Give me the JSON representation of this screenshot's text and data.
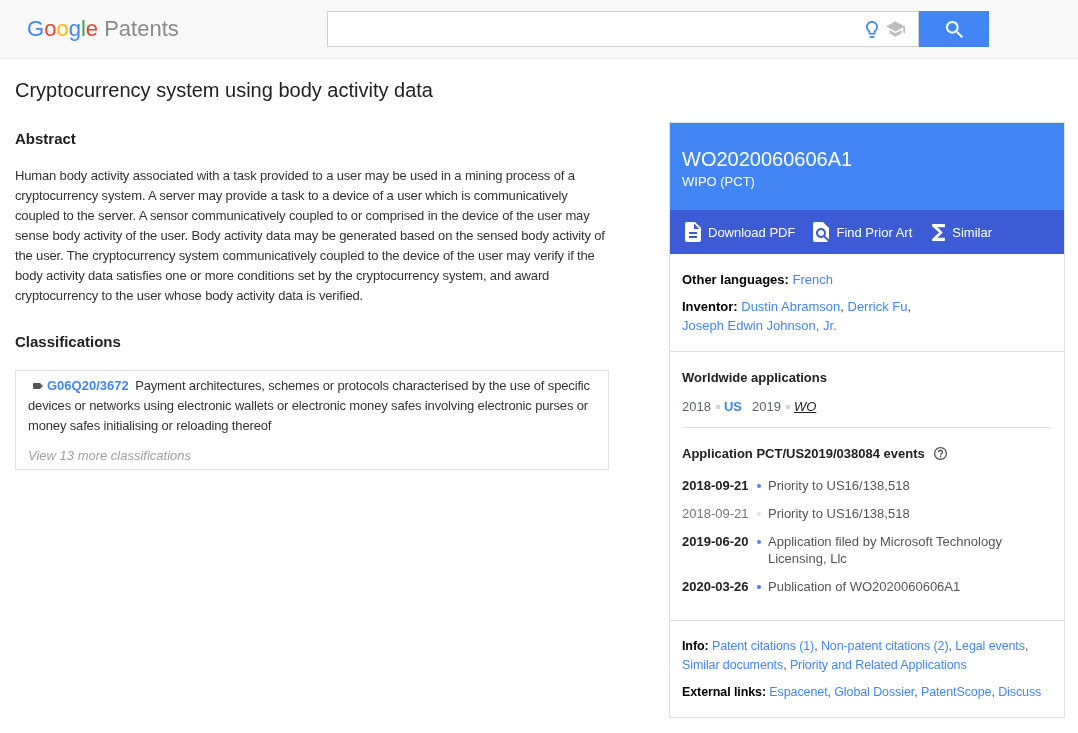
{
  "header": {
    "logo": {
      "brand": "Google",
      "product": "Patents"
    }
  },
  "title": "Cryptocurrency system using body activity data",
  "abstract": {
    "heading": "Abstract",
    "text": "Human body activity associated with a task provided to a user may be used in a mining process of a cryptocurrency system. A server may provide a task to a device of a user which is communicatively coupled to the server. A sensor communicatively coupled to or comprised in the device of the user may sense body activity of the user. Body activity data may be generated based on the sensed body activity of the user. The cryptocurrency system communicatively coupled to the device of the user may verify if the body activity data satisfies one or more conditions set by the cryptocurrency system, and award cryptocurrency to the user whose body activity data is verified."
  },
  "classifications": {
    "heading": "Classifications",
    "items": [
      {
        "code": "G06Q20/3672",
        "description": "Payment architectures, schemes or protocols characterised by the use of specific devices or networks using electronic wallets or electronic money safes involving electronic purses or money safes initialising or reloading thereof"
      }
    ],
    "more": "View 13 more classifications"
  },
  "patent_card": {
    "number": "WO2020060606A1",
    "office": "WIPO (PCT)",
    "actions": [
      {
        "kind": "pdf",
        "label": "Download PDF"
      },
      {
        "kind": "prior_art",
        "label": "Find Prior Art"
      },
      {
        "kind": "similar",
        "label": "Similar"
      }
    ],
    "separator": ",",
    "details": [
      {
        "label": "Other languages:",
        "links": [
          "French"
        ]
      },
      {
        "label": "Inventor:",
        "links": [
          "Dustin Abramson",
          "Derrick Fu",
          "Joseph Edwin Johnson, Jr."
        ]
      }
    ],
    "worldwide": {
      "heading": "Worldwide applications",
      "items": [
        {
          "year": "2018",
          "country": "US",
          "selected": false
        },
        {
          "year": "2019",
          "country": "WO",
          "selected": true
        }
      ]
    },
    "events": {
      "heading": "Application PCT/US2019/038084 events",
      "items": [
        {
          "date": "2018-09-21",
          "text": "Priority to US16/138,518",
          "critical": true
        },
        {
          "date": "2018-09-21",
          "text": "Priority to US16/138,518",
          "critical": false
        },
        {
          "date": "2019-06-20",
          "text": "Application filed by Microsoft Technology Licensing, Llc",
          "critical": true
        },
        {
          "date": "2020-03-26",
          "text": "Publication of WO2020060606A1",
          "critical": true
        }
      ]
    },
    "info": [
      {
        "label": "Info:",
        "links": [
          "Patent citations (1)",
          "Non-patent citations (2)",
          "Legal events",
          "Similar documents",
          "Priority and Related Applications"
        ]
      },
      {
        "label": "External links:",
        "links": [
          "Espacenet",
          "Global Dossier",
          "PatentScope",
          "Discuss"
        ]
      }
    ]
  }
}
